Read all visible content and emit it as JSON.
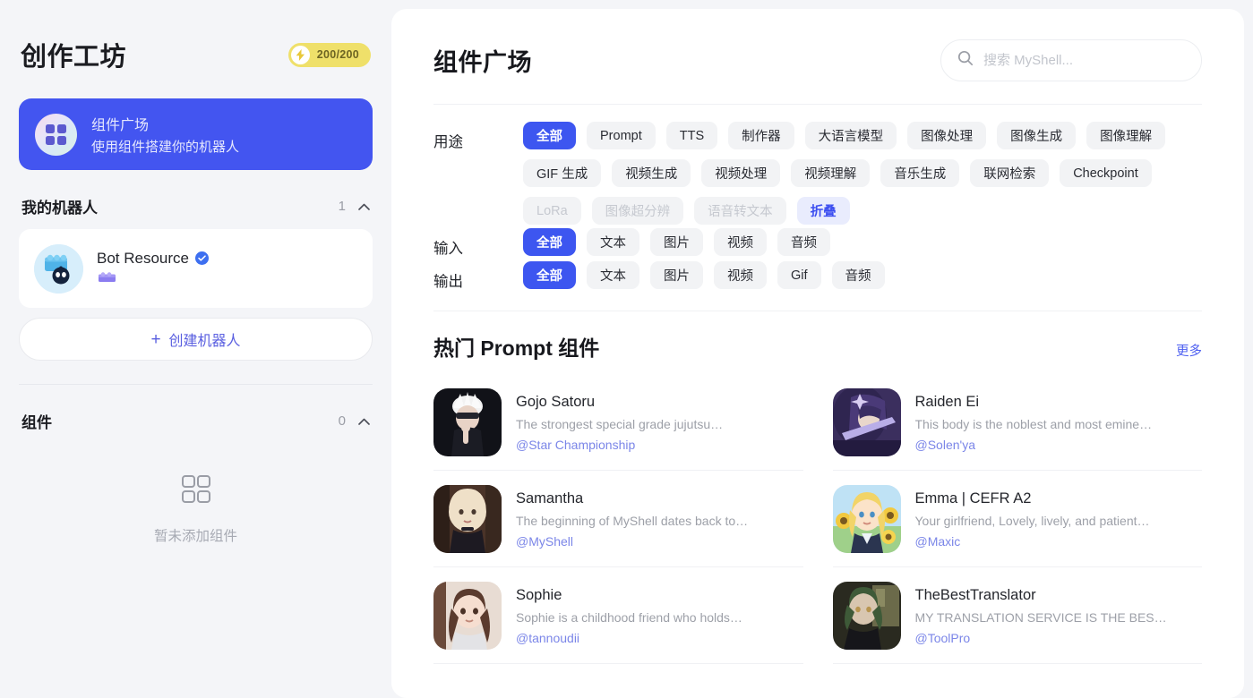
{
  "sidebar": {
    "title": "创作工坊",
    "credit": {
      "value": "200/200",
      "icon": "lightning-bolt-icon",
      "bg_color": "#efe06a"
    },
    "plaza_card": {
      "title": "组件广场",
      "subtitle": "使用组件搭建你的机器人",
      "icon": "grid-apps-icon",
      "bg_color": "#4355f0"
    },
    "my_bots": {
      "title": "我的机器人",
      "count": "1",
      "chevron": "chevron-up-icon",
      "bots": [
        {
          "name": "Bot Resource",
          "verified": true,
          "avatar": "lego-robot-avatar"
        }
      ],
      "create_label": "创建机器人",
      "create_plus": "+"
    },
    "components": {
      "title": "组件",
      "count": "0",
      "chevron": "chevron-up-icon",
      "empty_icon": "grid-four-squares-icon",
      "empty_text": "暂未添加组件"
    }
  },
  "main": {
    "page_title": "组件广场",
    "search": {
      "placeholder": "搜索 MyShell...",
      "value": "",
      "icon": "search-icon"
    },
    "filters": [
      {
        "label": "用途",
        "chips": [
          {
            "text": "全部",
            "state": "active"
          },
          {
            "text": "Prompt",
            "state": "normal"
          },
          {
            "text": "TTS",
            "state": "normal"
          },
          {
            "text": "制作器",
            "state": "normal"
          },
          {
            "text": "大语言模型",
            "state": "normal"
          },
          {
            "text": "图像处理",
            "state": "normal"
          },
          {
            "text": "图像生成",
            "state": "normal"
          },
          {
            "text": "图像理解",
            "state": "normal"
          },
          {
            "text": "GIF 生成",
            "state": "normal"
          },
          {
            "text": "视频生成",
            "state": "normal"
          },
          {
            "text": "视频处理",
            "state": "normal"
          },
          {
            "text": "视频理解",
            "state": "normal"
          },
          {
            "text": "音乐生成",
            "state": "normal"
          },
          {
            "text": "联网检索",
            "state": "normal"
          },
          {
            "text": "Checkpoint",
            "state": "normal"
          },
          {
            "text": "LoRa",
            "state": "disabled"
          },
          {
            "text": "图像超分辨",
            "state": "disabled"
          },
          {
            "text": "语音转文本",
            "state": "disabled"
          },
          {
            "text": "折叠",
            "state": "collapse"
          }
        ]
      },
      {
        "label": "输入",
        "chips": [
          {
            "text": "全部",
            "state": "active"
          },
          {
            "text": "文本",
            "state": "normal"
          },
          {
            "text": "图片",
            "state": "normal"
          },
          {
            "text": "视频",
            "state": "normal"
          },
          {
            "text": "音频",
            "state": "normal"
          }
        ]
      },
      {
        "label": "输出",
        "chips": [
          {
            "text": "全部",
            "state": "active"
          },
          {
            "text": "文本",
            "state": "normal"
          },
          {
            "text": "图片",
            "state": "normal"
          },
          {
            "text": "视频",
            "state": "normal"
          },
          {
            "text": "Gif",
            "state": "normal"
          },
          {
            "text": "音频",
            "state": "normal"
          }
        ]
      }
    ],
    "hot_section": {
      "title": "热门 Prompt 组件",
      "more_label": "更多",
      "items": [
        {
          "name": "Gojo Satoru",
          "desc": "The strongest special grade jujutsu…",
          "author": "@Star Championship",
          "thumb": "gojo-avatar"
        },
        {
          "name": "Raiden Ei",
          "desc": "This body is the noblest and most emine…",
          "author": "@Solen'ya",
          "thumb": "raiden-avatar"
        },
        {
          "name": "Samantha",
          "desc": "The beginning of MyShell dates back to…",
          "author": "@MyShell",
          "thumb": "samantha-avatar"
        },
        {
          "name": "Emma | CEFR A2",
          "desc": "Your girlfriend, Lovely, lively, and patient…",
          "author": "@Maxic",
          "thumb": "emma-avatar"
        },
        {
          "name": "Sophie",
          "desc": "Sophie is a childhood friend who holds…",
          "author": "@tannoudii",
          "thumb": "sophie-avatar"
        },
        {
          "name": "TheBestTranslator",
          "desc": "MY TRANSLATION SERVICE IS THE BES…",
          "author": "@ToolPro",
          "thumb": "translator-avatar"
        }
      ]
    }
  },
  "colors": {
    "accent": "#3d56f0",
    "badge": "#efe06a",
    "link": "#4c5ef0",
    "author": "#7b86e8"
  }
}
